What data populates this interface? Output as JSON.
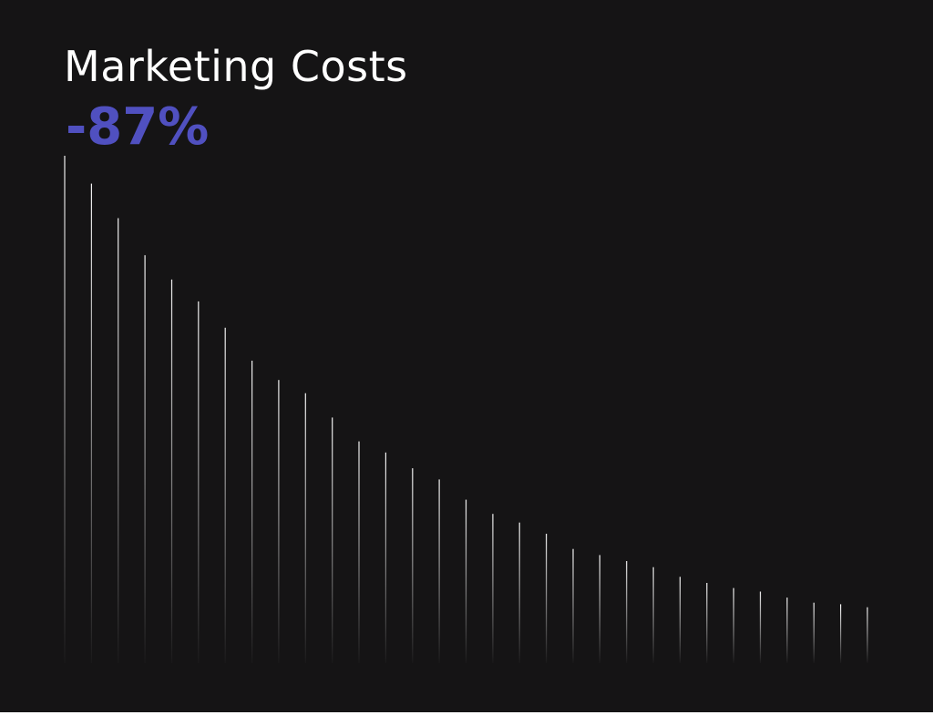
{
  "header": {
    "title": "Marketing Costs",
    "change": "-87%"
  },
  "colors": {
    "background": "#151415",
    "title": "#ffffff",
    "change": "#5050c0",
    "bar": "#ffffff"
  },
  "chart_data": {
    "type": "bar",
    "title": "Marketing Costs",
    "xlabel": "",
    "ylabel": "",
    "ylim": [
      0,
      100
    ],
    "grid": false,
    "values": [
      100,
      94.5,
      87.7,
      80.4,
      75.6,
      71.3,
      66.1,
      59.6,
      55.8,
      53.2,
      48.4,
      43.7,
      41.5,
      38.4,
      36.2,
      32.2,
      29.4,
      27.7,
      25.5,
      22.5,
      21.3,
      20.1,
      18.9,
      17.0,
      15.8,
      14.8,
      14.1,
      12.9,
      11.9,
      11.6,
      11.0
    ]
  }
}
